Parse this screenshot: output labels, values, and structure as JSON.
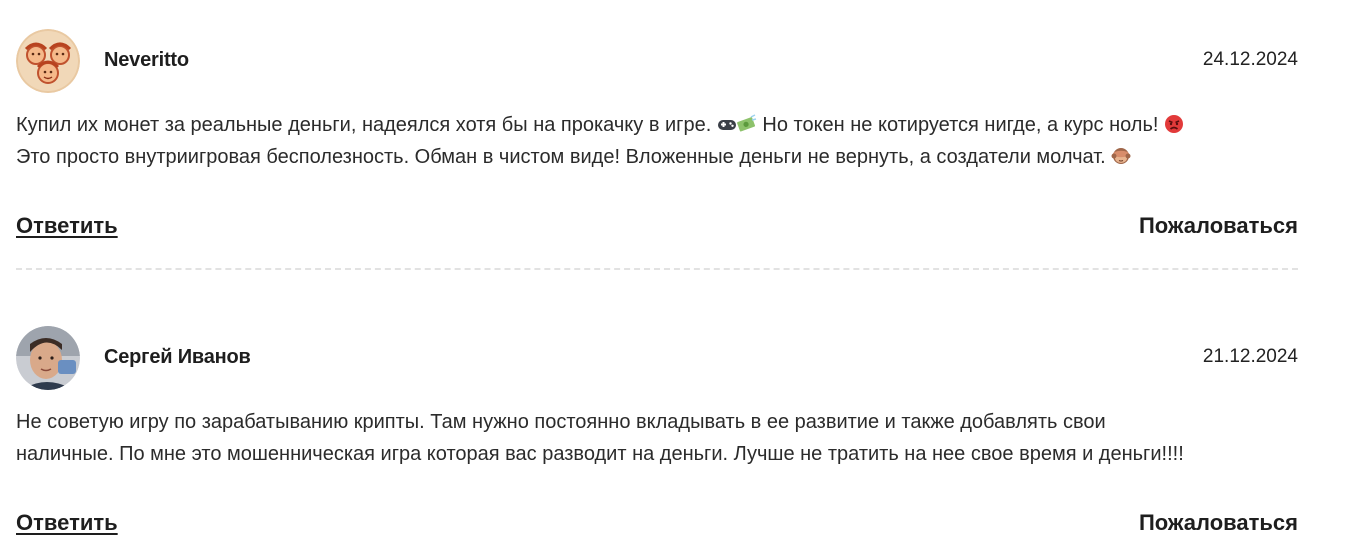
{
  "comments": [
    {
      "author": "Neveritto",
      "date": "24.12.2024",
      "text_line1_a": "Купил их монет за реальные деньги, надеялся хотя бы на прокачку в игре. ",
      "text_line1_b": " Но токен не котируется нигде, а курс ноль! ",
      "text_line2": "Это просто внутриигровая бесполезность. Обман в чистом виде! Вложенные деньги не вернуть, а создатели молчат. ",
      "emojis": [
        "gamepad-icon",
        "money-icon",
        "angry-face-icon",
        "see-no-evil-monkey-icon"
      ],
      "reply_label": "Ответить",
      "report_label": "Пожаловаться"
    },
    {
      "author": "Сергей Иванов",
      "date": "21.12.2024",
      "text_line1": "Не советую игру по зарабатыванию крипты. Там нужно постоянно вкладывать в ее развитие и также добавлять свои",
      "text_line2": "наличные. По мне это мошенническая игра которая вас разводит на деньги. Лучше не тратить на нее свое время и деньги!!!!",
      "reply_label": "Ответить",
      "report_label": "Пожаловаться"
    }
  ]
}
